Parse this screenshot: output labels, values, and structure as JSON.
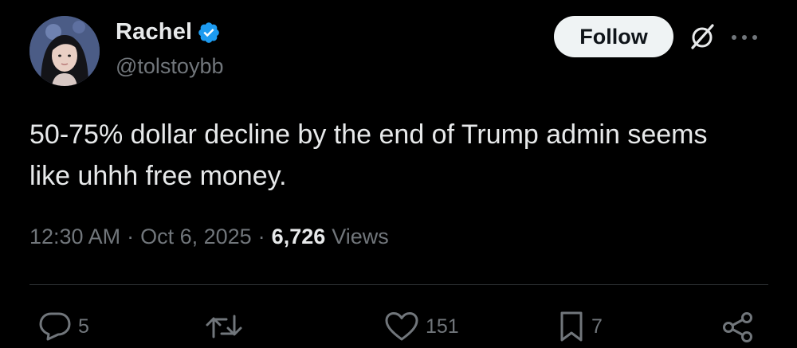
{
  "author": {
    "name": "Rachel",
    "handle": "@tolstoybb",
    "verified": true,
    "verified_color": "#1d9bf0"
  },
  "header": {
    "follow_label": "Follow",
    "icons": [
      "grok-icon",
      "more-icon"
    ]
  },
  "tweet": {
    "text": "50-75% dollar decline by the end of Trump admin seems like uhhh free money."
  },
  "meta": {
    "time": "12:30 AM",
    "date": "Oct 6, 2025",
    "separator": "·",
    "views_count": "6,726",
    "views_label": "Views"
  },
  "actions": {
    "replies": "5",
    "reposts": "",
    "likes": "151",
    "bookmarks": "7"
  },
  "colors": {
    "background": "#000000",
    "text_primary": "#e7e9ea",
    "text_secondary": "#71767b",
    "divider": "#2f3336",
    "follow_bg": "#eff3f4"
  }
}
